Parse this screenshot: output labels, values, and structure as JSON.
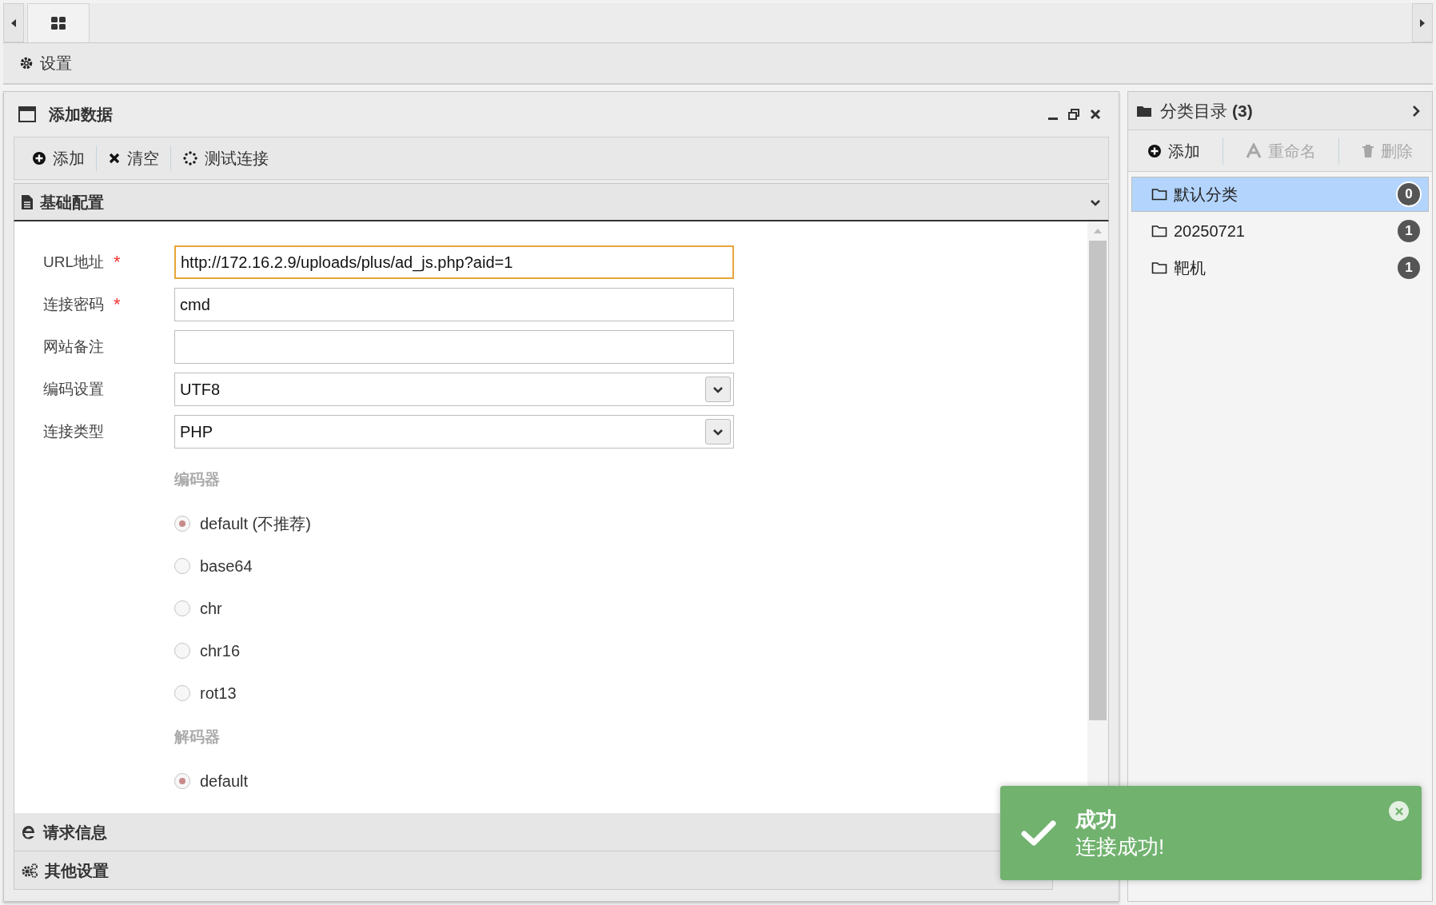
{
  "settings_bar": {
    "label": "设置"
  },
  "panel": {
    "title": "添加数据",
    "toolbar": [
      {
        "kind": "add",
        "label": "添加"
      },
      {
        "kind": "clear",
        "label": "清空"
      },
      {
        "kind": "test",
        "label": "测试连接"
      }
    ],
    "sections": [
      {
        "kind": "basic",
        "title": "基础配置",
        "expanded": true
      },
      {
        "kind": "request",
        "title": "请求信息",
        "expanded": false
      },
      {
        "kind": "other",
        "title": "其他设置",
        "expanded": false
      }
    ],
    "form": {
      "fields": [
        {
          "kind": "text",
          "label": "URL地址",
          "marker": "*",
          "value": "http://172.16.2.9/uploads/plus/ad_js.php?aid=1",
          "focused": true
        },
        {
          "kind": "text",
          "label": "连接密码",
          "marker": "*",
          "value": "cmd",
          "focused": false
        },
        {
          "kind": "text",
          "label": "网站备注",
          "focused": false
        },
        {
          "kind": "select",
          "label": "编码设置",
          "value": "UTF8",
          "focused": false
        },
        {
          "kind": "select",
          "label": "连接类型",
          "value": "PHP",
          "focused": false
        }
      ],
      "groups": [
        {
          "label": "编码器",
          "options": [
            {
              "label": "default (不推荐)",
              "selected": true
            },
            {
              "label": "base64",
              "selected": false
            },
            {
              "label": "chr",
              "selected": false
            },
            {
              "label": "chr16",
              "selected": false
            },
            {
              "label": "rot13",
              "selected": false
            }
          ]
        },
        {
          "label": "解码器",
          "options": [
            {
              "label": "default",
              "selected": true
            }
          ]
        }
      ]
    }
  },
  "categories": {
    "title": "分类目录",
    "count": "(3)",
    "toolbar": [
      {
        "kind": "add",
        "label": "添加",
        "disabled": false
      },
      {
        "kind": "rename",
        "label": "重命名",
        "disabled": true
      },
      {
        "kind": "delete",
        "label": "删除",
        "disabled": true
      }
    ],
    "items": [
      {
        "name": "默认分类",
        "count": "0",
        "selected": true
      },
      {
        "name": "20250721",
        "count": "1",
        "selected": false
      },
      {
        "name": "靶机",
        "count": "1",
        "selected": false
      }
    ]
  },
  "toast": {
    "title": "成功",
    "message": "连接成功!"
  }
}
